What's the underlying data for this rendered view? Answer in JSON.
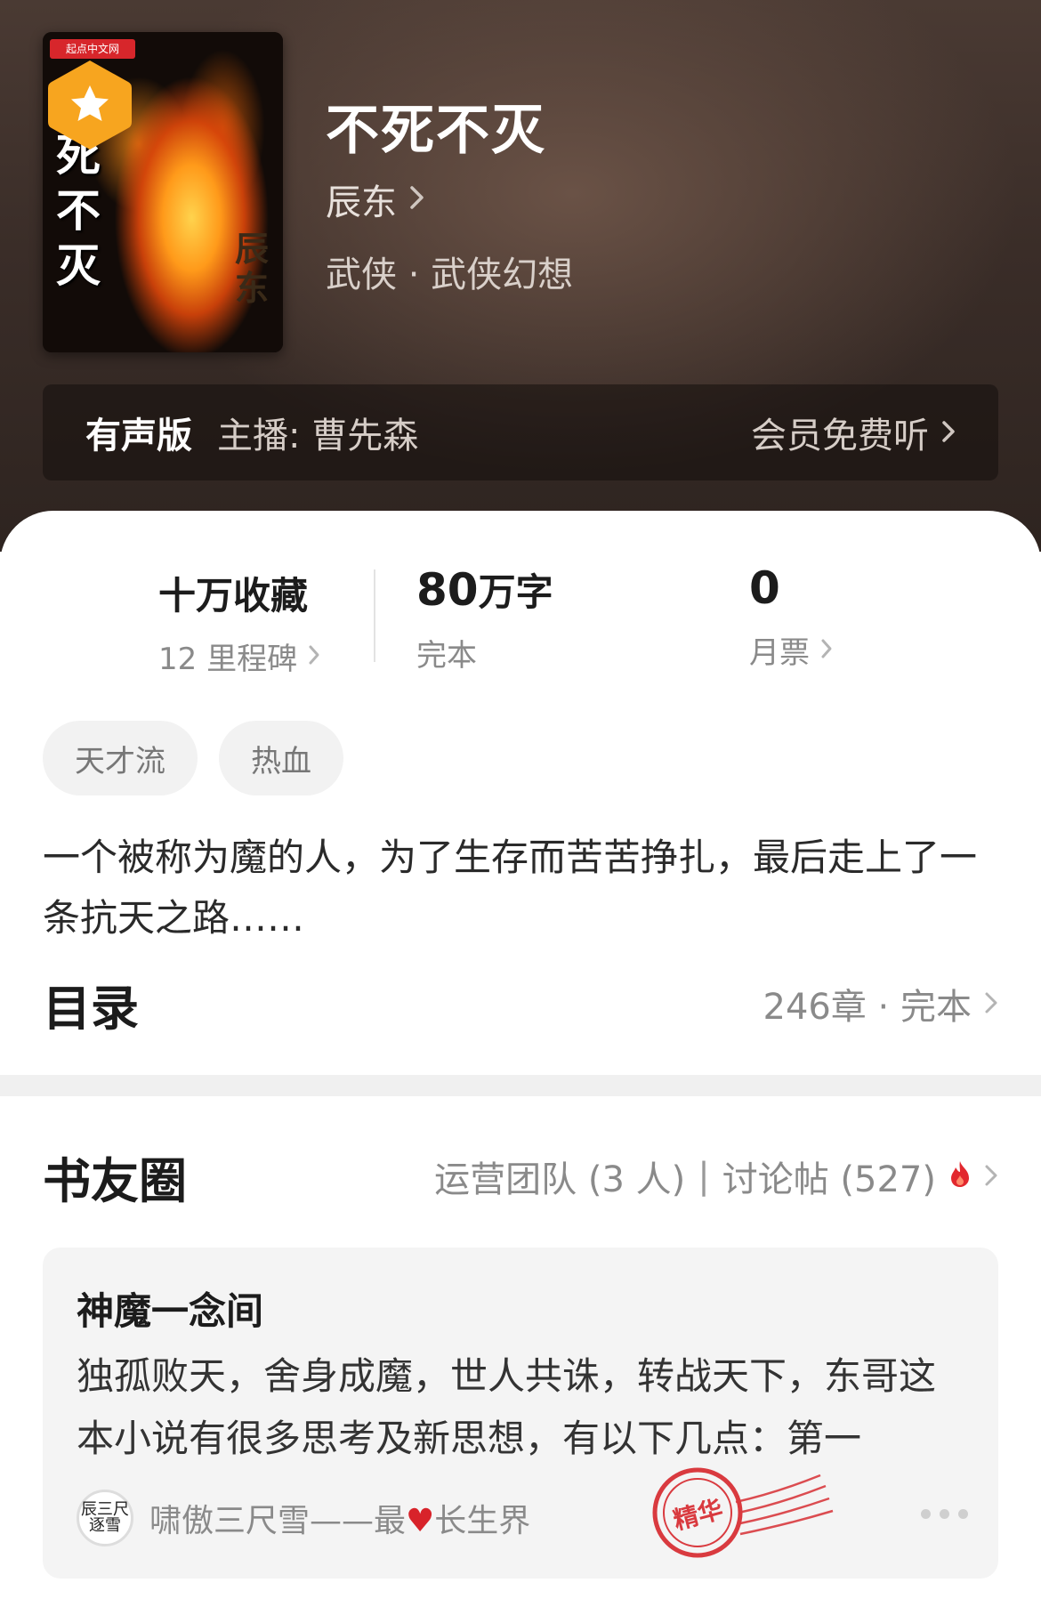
{
  "book": {
    "title": "不死不灭",
    "author": "辰东",
    "genre": "武侠 · 武侠幻想",
    "cover": {
      "title_chars": "不死不灭",
      "author_chars": "辰东",
      "publisher": "起点中文网"
    }
  },
  "audio": {
    "badge": "有声版",
    "narrator": "主播: 曹先森",
    "action": "会员免费听"
  },
  "stats": {
    "collections": "十万收藏",
    "milestones": "12 里程碑",
    "word_count_num": "80",
    "word_count_unit": "万字",
    "status": "完本",
    "monthly_votes": "0",
    "monthly_votes_label": "月票"
  },
  "tags": [
    "天才流",
    "热血"
  ],
  "intro": "一个被称为魔的人，为了生存而苦苦挣扎，最后走上了一条抗天之路……",
  "toc": {
    "title": "目录",
    "meta": "246章 · 完本"
  },
  "circle": {
    "title": "书友圈",
    "team": "运营团队 (3 人)",
    "separator": "|",
    "posts": "讨论帖 (527)"
  },
  "post": {
    "title": "神魔一念间",
    "body": "独孤败天，舍身成魔，世人共诛，转战天下，东哥这本小说有很多思考及新思想，有以下几点：第一",
    "user_prefix": "啸傲三尺雪——最",
    "user_heart": "♥",
    "user_suffix": "长生界",
    "avatar_text": "辰三尺 逐雪",
    "stamp_text": "精华"
  },
  "colors": {
    "accent_orange": "#f7a51f",
    "hot_red": "#e2282e",
    "stamp_red": "#d93a3f"
  }
}
